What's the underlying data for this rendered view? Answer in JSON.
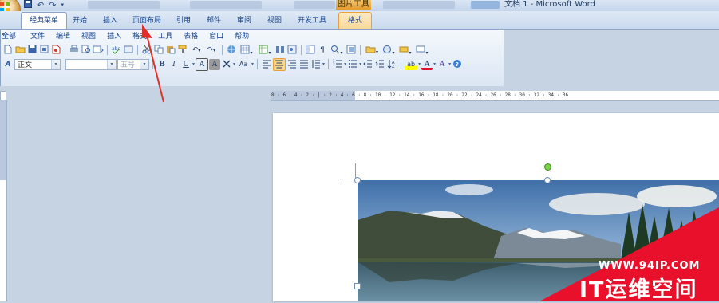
{
  "window": {
    "title": "文档 1 - Microsoft Word",
    "contextual_tab_group": "图片工具",
    "quick_access": [
      "save-icon",
      "undo-icon",
      "redo-icon",
      "customize-icon"
    ]
  },
  "tabs": [
    {
      "label": "经典菜单",
      "active": true
    },
    {
      "label": "开始"
    },
    {
      "label": "插入"
    },
    {
      "label": "页面布局"
    },
    {
      "label": "引用"
    },
    {
      "label": "邮件"
    },
    {
      "label": "审阅"
    },
    {
      "label": "视图"
    },
    {
      "label": "开发工具"
    },
    {
      "label": "格式",
      "contextual": true
    }
  ],
  "menus": [
    {
      "label": "全部"
    },
    {
      "label": "文件"
    },
    {
      "label": "编辑"
    },
    {
      "label": "视图"
    },
    {
      "label": "插入"
    },
    {
      "label": "格式"
    },
    {
      "label": "工具"
    },
    {
      "label": "表格"
    },
    {
      "label": "窗口"
    },
    {
      "label": "帮助"
    }
  ],
  "format_bar": {
    "style_value": "正文",
    "font_value": "",
    "size_value": "五号"
  },
  "toolbar_glyphs": {
    "bold": "B",
    "italic": "I",
    "underline": "U",
    "char_border": "A",
    "char_shading": "A",
    "change_case": "Aa",
    "font_color": "A",
    "text_effect": "A",
    "highlight": "ab"
  },
  "ruler": {
    "ticks": "8 · 6 · 4 · 2 · │ · 2 · 4 · 6 · 8 · 10 · 12 · 14 · 16 · 18 · 20 · 22 · 24 · 26 · 28 · 30 · 32 · 34 · 36"
  },
  "watermark": {
    "url": "WWW.94IP.COM",
    "name": "IT运维空间"
  },
  "colors": {
    "ribbon_bg": "#dbe6f4",
    "tab_text": "#15428b",
    "contextual_orange": "#e39a2c",
    "watermark_red": "#e8102a",
    "annotation_arrow": "#e0302c"
  }
}
